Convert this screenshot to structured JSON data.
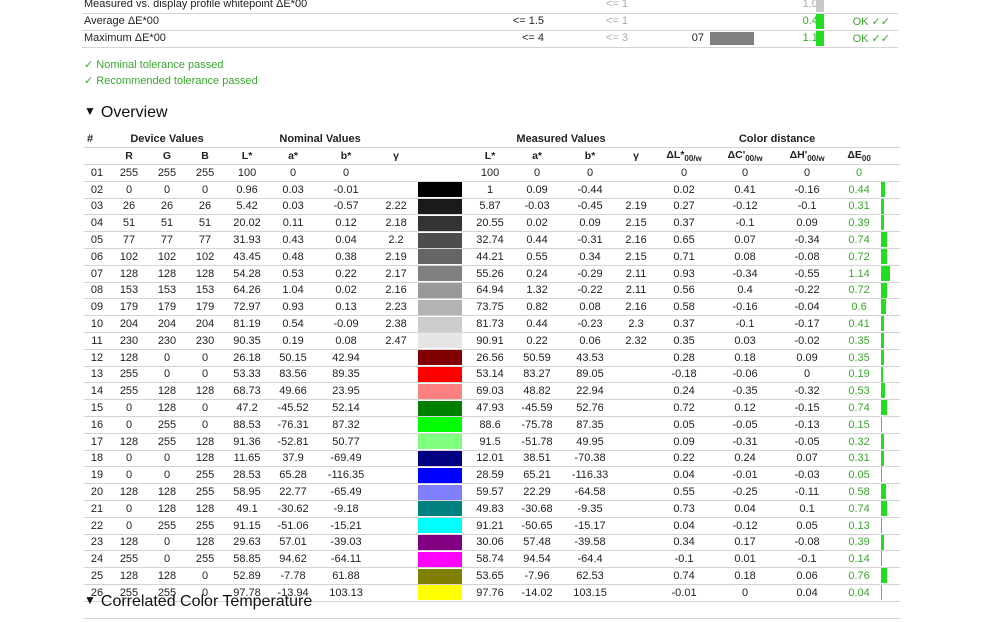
{
  "summary": [
    {
      "label": "Measured vs. display profile whitepoint ΔE*00",
      "nominal": "",
      "recommended": "<= 1",
      "num": "",
      "value": "1.01",
      "value_gray": true,
      "bar": "gray",
      "ok": ""
    },
    {
      "label": "Average ΔE*00",
      "nominal": "<= 1.5",
      "recommended": "<= 1",
      "num": "",
      "value": "0.43",
      "value_gray": false,
      "bar": "green",
      "ok": "OK ✓✓"
    },
    {
      "label": "Maximum ΔE*00",
      "nominal": "<= 4",
      "recommended": "<= 3",
      "num": "07",
      "value": "1.14",
      "value_gray": false,
      "bar": "green",
      "ok": "OK ✓✓",
      "swatch": "#808080"
    }
  ],
  "checks": [
    "✓ Nominal tolerance passed",
    "✓ Recommended tolerance passed"
  ],
  "sections": {
    "overview": "Overview",
    "cct": "Correlated Color Temperature",
    "tri": "▼"
  },
  "headers": {
    "num": "#",
    "device": "Device Values",
    "nominal": "Nominal Values",
    "measured": "Measured Values",
    "distance": "Color distance",
    "R": "R",
    "G": "G",
    "B": "B",
    "L": "L*",
    "a": "a*",
    "b": "b*",
    "gamma": "γ",
    "dL": "ΔL*",
    "dC": "ΔC'",
    "dH": "ΔH'",
    "dE": "ΔE",
    "sub_w": "00/w",
    "sub_00": "00"
  },
  "rows": [
    {
      "n": "01",
      "R": "255",
      "G": "255",
      "B": "255",
      "nL": "100",
      "na": "0",
      "nb": "0",
      "ng": "",
      "color": "#ffffff",
      "mL": "100",
      "ma": "0",
      "mb": "0",
      "mg": "",
      "dL": "0",
      "dC": "0",
      "dH": "0",
      "dE": "0"
    },
    {
      "n": "02",
      "R": "0",
      "G": "0",
      "B": "0",
      "nL": "0.96",
      "na": "0.03",
      "nb": "-0.01",
      "ng": "",
      "color": "#000000",
      "mL": "1",
      "ma": "0.09",
      "mb": "-0.44",
      "mg": "",
      "dL": "0.02",
      "dC": "0.41",
      "dH": "-0.16",
      "dE": "0.44"
    },
    {
      "n": "03",
      "R": "26",
      "G": "26",
      "B": "26",
      "nL": "5.42",
      "na": "0.03",
      "nb": "-0.57",
      "ng": "2.22",
      "color": "#1a1a1a",
      "mL": "5.87",
      "ma": "-0.03",
      "mb": "-0.45",
      "mg": "2.19",
      "dL": "0.27",
      "dC": "-0.12",
      "dH": "-0.1",
      "dE": "0.31"
    },
    {
      "n": "04",
      "R": "51",
      "G": "51",
      "B": "51",
      "nL": "20.02",
      "na": "0.11",
      "nb": "0.12",
      "ng": "2.18",
      "color": "#333333",
      "mL": "20.55",
      "ma": "0.02",
      "mb": "0.09",
      "mg": "2.15",
      "dL": "0.37",
      "dC": "-0.1",
      "dH": "0.09",
      "dE": "0.39"
    },
    {
      "n": "05",
      "R": "77",
      "G": "77",
      "B": "77",
      "nL": "31.93",
      "na": "0.43",
      "nb": "0.04",
      "ng": "2.2",
      "color": "#4d4d4d",
      "mL": "32.74",
      "ma": "0.44",
      "mb": "-0.31",
      "mg": "2.16",
      "dL": "0.65",
      "dC": "0.07",
      "dH": "-0.34",
      "dE": "0.74"
    },
    {
      "n": "06",
      "R": "102",
      "G": "102",
      "B": "102",
      "nL": "43.45",
      "na": "0.48",
      "nb": "0.38",
      "ng": "2.19",
      "color": "#666666",
      "mL": "44.21",
      "ma": "0.55",
      "mb": "0.34",
      "mg": "2.15",
      "dL": "0.71",
      "dC": "0.08",
      "dH": "-0.08",
      "dE": "0.72"
    },
    {
      "n": "07",
      "R": "128",
      "G": "128",
      "B": "128",
      "nL": "54.28",
      "na": "0.53",
      "nb": "0.22",
      "ng": "2.17",
      "color": "#808080",
      "mL": "55.26",
      "ma": "0.24",
      "mb": "-0.29",
      "mg": "2.11",
      "dL": "0.93",
      "dC": "-0.34",
      "dH": "-0.55",
      "dE": "1.14"
    },
    {
      "n": "08",
      "R": "153",
      "G": "153",
      "B": "153",
      "nL": "64.26",
      "na": "1.04",
      "nb": "0.02",
      "ng": "2.16",
      "color": "#999999",
      "mL": "64.94",
      "ma": "1.32",
      "mb": "-0.22",
      "mg": "2.11",
      "dL": "0.56",
      "dC": "0.4",
      "dH": "-0.22",
      "dE": "0.72"
    },
    {
      "n": "09",
      "R": "179",
      "G": "179",
      "B": "179",
      "nL": "72.97",
      "na": "0.93",
      "nb": "0.13",
      "ng": "2.23",
      "color": "#b3b3b3",
      "mL": "73.75",
      "ma": "0.82",
      "mb": "0.08",
      "mg": "2.16",
      "dL": "0.58",
      "dC": "-0.16",
      "dH": "-0.04",
      "dE": "0.6"
    },
    {
      "n": "10",
      "R": "204",
      "G": "204",
      "B": "204",
      "nL": "81.19",
      "na": "0.54",
      "nb": "-0.09",
      "ng": "2.38",
      "color": "#cccccc",
      "mL": "81.73",
      "ma": "0.44",
      "mb": "-0.23",
      "mg": "2.3",
      "dL": "0.37",
      "dC": "-0.1",
      "dH": "-0.17",
      "dE": "0.41"
    },
    {
      "n": "11",
      "R": "230",
      "G": "230",
      "B": "230",
      "nL": "90.35",
      "na": "0.19",
      "nb": "0.08",
      "ng": "2.47",
      "color": "#e6e6e6",
      "mL": "90.91",
      "ma": "0.22",
      "mb": "0.06",
      "mg": "2.32",
      "dL": "0.35",
      "dC": "0.03",
      "dH": "-0.02",
      "dE": "0.35"
    },
    {
      "n": "12",
      "R": "128",
      "G": "0",
      "B": "0",
      "nL": "26.18",
      "na": "50.15",
      "nb": "42.94",
      "ng": "",
      "color": "#800000",
      "mL": "26.56",
      "ma": "50.59",
      "mb": "43.53",
      "mg": "",
      "dL": "0.28",
      "dC": "0.18",
      "dH": "0.09",
      "dE": "0.35"
    },
    {
      "n": "13",
      "R": "255",
      "G": "0",
      "B": "0",
      "nL": "53.33",
      "na": "83.56",
      "nb": "89.35",
      "ng": "",
      "color": "#ff0000",
      "mL": "53.14",
      "ma": "83.27",
      "mb": "89.05",
      "mg": "",
      "dL": "-0.18",
      "dC": "-0.06",
      "dH": "0",
      "dE": "0.19"
    },
    {
      "n": "14",
      "R": "255",
      "G": "128",
      "B": "128",
      "nL": "68.73",
      "na": "49.66",
      "nb": "23.95",
      "ng": "",
      "color": "#ff8080",
      "mL": "69.03",
      "ma": "48.82",
      "mb": "22.94",
      "mg": "",
      "dL": "0.24",
      "dC": "-0.35",
      "dH": "-0.32",
      "dE": "0.53"
    },
    {
      "n": "15",
      "R": "0",
      "G": "128",
      "B": "0",
      "nL": "47.2",
      "na": "-45.52",
      "nb": "52.14",
      "ng": "",
      "color": "#008000",
      "mL": "47.93",
      "ma": "-45.59",
      "mb": "52.76",
      "mg": "",
      "dL": "0.72",
      "dC": "0.12",
      "dH": "-0.15",
      "dE": "0.74"
    },
    {
      "n": "16",
      "R": "0",
      "G": "255",
      "B": "0",
      "nL": "88.53",
      "na": "-76.31",
      "nb": "87.32",
      "ng": "",
      "color": "#00ff00",
      "mL": "88.6",
      "ma": "-75.78",
      "mb": "87.35",
      "mg": "",
      "dL": "0.05",
      "dC": "-0.05",
      "dH": "-0.13",
      "dE": "0.15"
    },
    {
      "n": "17",
      "R": "128",
      "G": "255",
      "B": "128",
      "nL": "91.36",
      "na": "-52.81",
      "nb": "50.77",
      "ng": "",
      "color": "#80ff80",
      "mL": "91.5",
      "ma": "-51.78",
      "mb": "49.95",
      "mg": "",
      "dL": "0.09",
      "dC": "-0.31",
      "dH": "-0.05",
      "dE": "0.32"
    },
    {
      "n": "18",
      "R": "0",
      "G": "0",
      "B": "128",
      "nL": "11.65",
      "na": "37.9",
      "nb": "-69.49",
      "ng": "",
      "color": "#000080",
      "mL": "12.01",
      "ma": "38.51",
      "mb": "-70.38",
      "mg": "",
      "dL": "0.22",
      "dC": "0.24",
      "dH": "0.07",
      "dE": "0.31"
    },
    {
      "n": "19",
      "R": "0",
      "G": "0",
      "B": "255",
      "nL": "28.53",
      "na": "65.28",
      "nb": "-116.35",
      "ng": "",
      "color": "#0000ff",
      "mL": "28.59",
      "ma": "65.21",
      "mb": "-116.33",
      "mg": "",
      "dL": "0.04",
      "dC": "-0.01",
      "dH": "-0.03",
      "dE": "0.05"
    },
    {
      "n": "20",
      "R": "128",
      "G": "128",
      "B": "255",
      "nL": "58.95",
      "na": "22.77",
      "nb": "-65.49",
      "ng": "",
      "color": "#8080ff",
      "mL": "59.57",
      "ma": "22.29",
      "mb": "-64.58",
      "mg": "",
      "dL": "0.55",
      "dC": "-0.25",
      "dH": "-0.11",
      "dE": "0.58"
    },
    {
      "n": "21",
      "R": "0",
      "G": "128",
      "B": "128",
      "nL": "49.1",
      "na": "-30.62",
      "nb": "-9.18",
      "ng": "",
      "color": "#008080",
      "mL": "49.83",
      "ma": "-30.68",
      "mb": "-9.35",
      "mg": "",
      "dL": "0.73",
      "dC": "0.04",
      "dH": "0.1",
      "dE": "0.74"
    },
    {
      "n": "22",
      "R": "0",
      "G": "255",
      "B": "255",
      "nL": "91.15",
      "na": "-51.06",
      "nb": "-15.21",
      "ng": "",
      "color": "#00ffff",
      "mL": "91.21",
      "ma": "-50.65",
      "mb": "-15.17",
      "mg": "",
      "dL": "0.04",
      "dC": "-0.12",
      "dH": "0.05",
      "dE": "0.13"
    },
    {
      "n": "23",
      "R": "128",
      "G": "0",
      "B": "128",
      "nL": "29.63",
      "na": "57.01",
      "nb": "-39.03",
      "ng": "",
      "color": "#800080",
      "mL": "30.06",
      "ma": "57.48",
      "mb": "-39.58",
      "mg": "",
      "dL": "0.34",
      "dC": "0.17",
      "dH": "-0.08",
      "dE": "0.39"
    },
    {
      "n": "24",
      "R": "255",
      "G": "0",
      "B": "255",
      "nL": "58.85",
      "na": "94.62",
      "nb": "-64.11",
      "ng": "",
      "color": "#ff00ff",
      "mL": "58.74",
      "ma": "94.54",
      "mb": "-64.4",
      "mg": "",
      "dL": "-0.1",
      "dC": "0.01",
      "dH": "-0.1",
      "dE": "0.14"
    },
    {
      "n": "25",
      "R": "128",
      "G": "128",
      "B": "0",
      "nL": "52.89",
      "na": "-7.78",
      "nb": "61.88",
      "ng": "",
      "color": "#808000",
      "mL": "53.65",
      "ma": "-7.96",
      "mb": "62.53",
      "mg": "",
      "dL": "0.74",
      "dC": "0.18",
      "dH": "0.06",
      "dE": "0.76"
    },
    {
      "n": "26",
      "R": "255",
      "G": "255",
      "B": "0",
      "nL": "97.78",
      "na": "-13.94",
      "nb": "103.13",
      "ng": "",
      "color": "#ffff00",
      "mL": "97.76",
      "ma": "-14.02",
      "mb": "103.15",
      "mg": "",
      "dL": "-0.01",
      "dC": "0",
      "dH": "0.04",
      "dE": "0.04"
    }
  ]
}
